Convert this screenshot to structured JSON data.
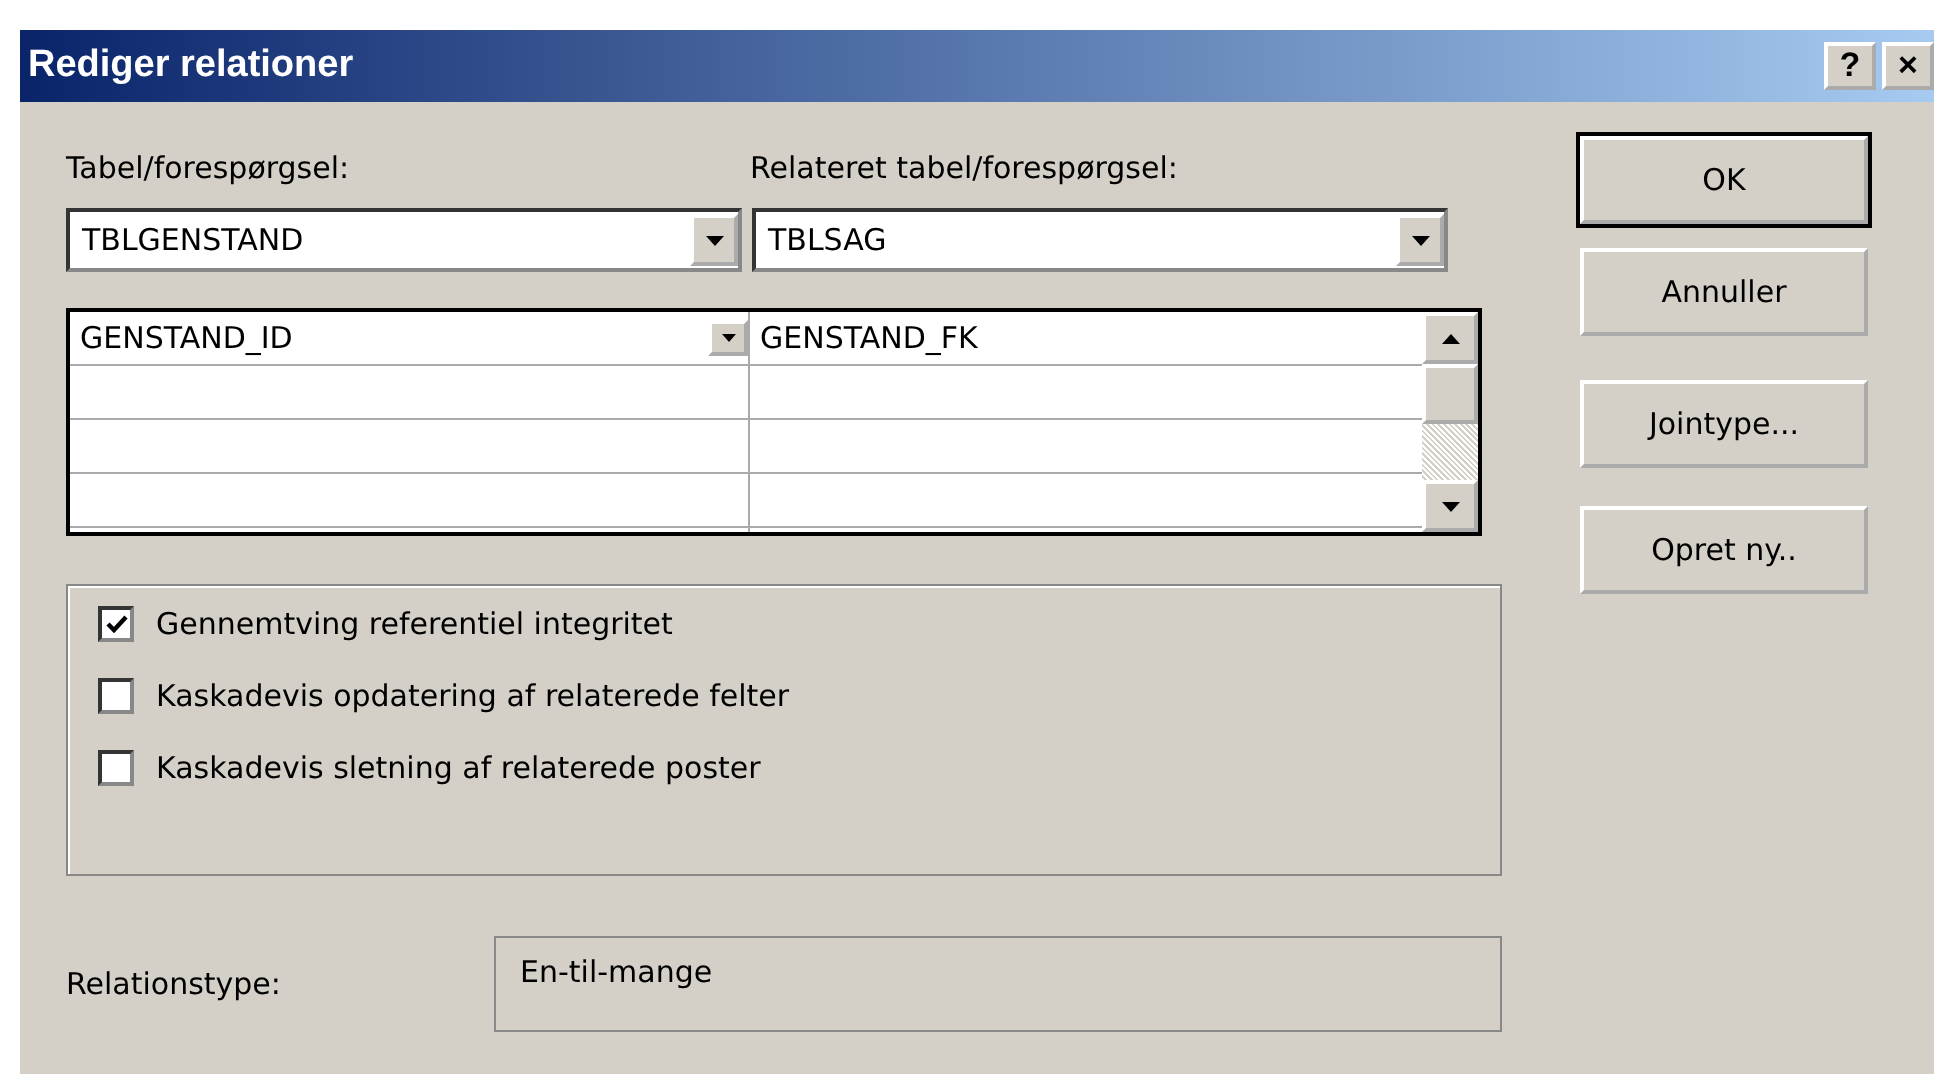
{
  "window": {
    "title": "Rediger relationer",
    "title_buttons": [
      "?",
      "×"
    ]
  },
  "table_label": "Tabel/forespørgsel:",
  "related_label": "Relateret tabel/forespørgsel:",
  "table_combo": {
    "value": "TBLGENSTAND"
  },
  "related_combo": {
    "value": "TBLSAG"
  },
  "fields": [
    {
      "left": "GENSTAND_ID",
      "right": "GENSTAND_FK"
    }
  ],
  "options": [
    {
      "label": "Gennemtving referentiel integritet",
      "checked": true
    },
    {
      "label": "Kaskadevis opdatering af relaterede felter",
      "checked": false
    },
    {
      "label": "Kaskadevis sletning af relaterede poster",
      "checked": false
    }
  ],
  "relation_type": {
    "label": "Relationstype:",
    "value": "En-til-mange"
  },
  "buttons": [
    {
      "label": "OK",
      "default": true
    },
    {
      "label": "Annuller",
      "default": false
    },
    {
      "label": "Jointype...",
      "default": false
    },
    {
      "label": "Opret ny..",
      "default": false
    }
  ]
}
